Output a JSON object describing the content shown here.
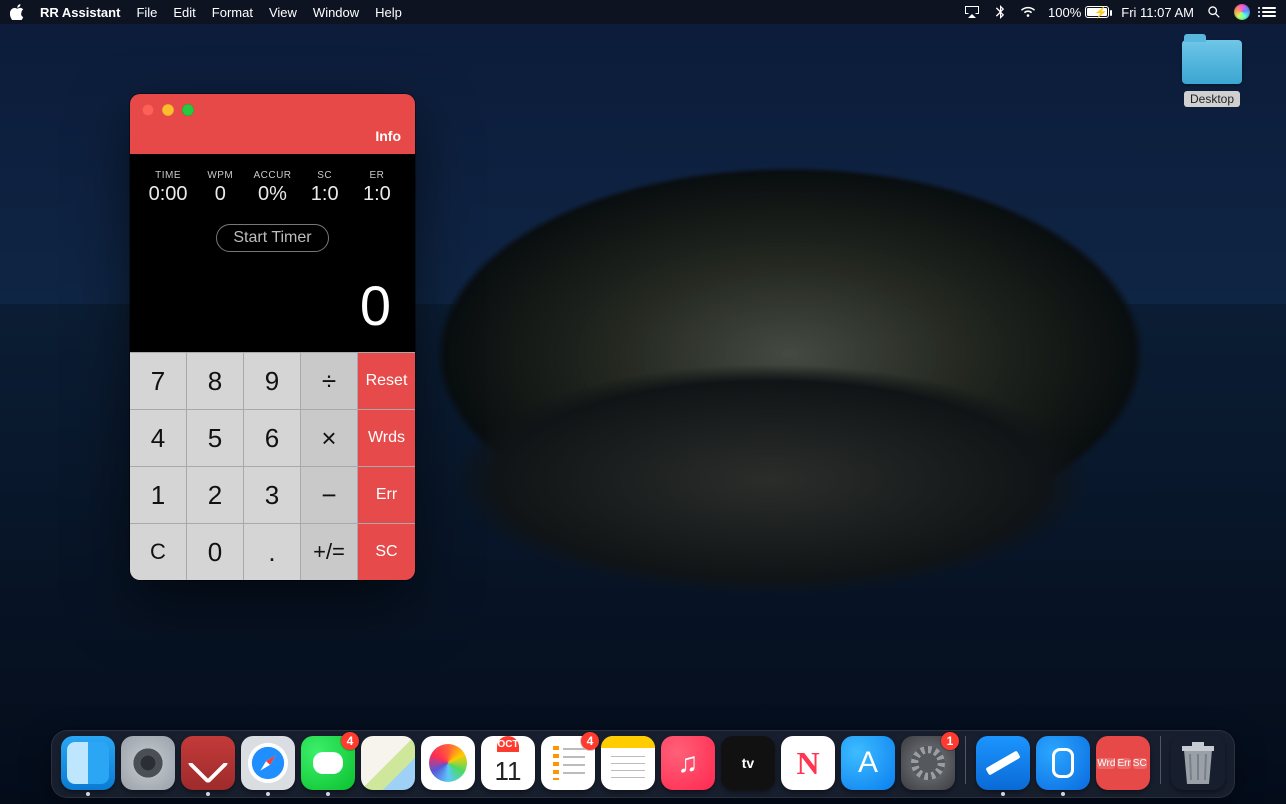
{
  "menubar": {
    "app_name": "RR Assistant",
    "menus": [
      "File",
      "Edit",
      "Format",
      "View",
      "Window",
      "Help"
    ],
    "battery_pct": "100%",
    "clock": "Fri 11:07 AM"
  },
  "desktop": {
    "folder_label": "Desktop"
  },
  "app": {
    "info_label": "Info",
    "stats": {
      "time": {
        "label": "TIME",
        "value": "0:00"
      },
      "wpm": {
        "label": "WPM",
        "value": "0"
      },
      "accur": {
        "label": "ACCUR",
        "value": "0%"
      },
      "sc": {
        "label": "SC",
        "value": "1:0"
      },
      "er": {
        "label": "ER",
        "value": "1:0"
      }
    },
    "start_timer": "Start Timer",
    "display_value": "0",
    "keys": {
      "r1": [
        "7",
        "8",
        "9",
        "÷"
      ],
      "r2": [
        "4",
        "5",
        "6",
        "×"
      ],
      "r3": [
        "1",
        "2",
        "3",
        "−"
      ],
      "r4": [
        "C",
        "0",
        ".",
        "+/="
      ],
      "fn": [
        "Reset",
        "Wrds",
        "Err",
        "SC"
      ]
    }
  },
  "dock": {
    "calendar": {
      "month": "OCT",
      "day": "11"
    },
    "tv_label": "tv",
    "rr_tiles": [
      "Wrd",
      "Err",
      "SC",
      ""
    ],
    "badges": {
      "messages": "4",
      "reminders": "4",
      "settings": "1"
    }
  }
}
